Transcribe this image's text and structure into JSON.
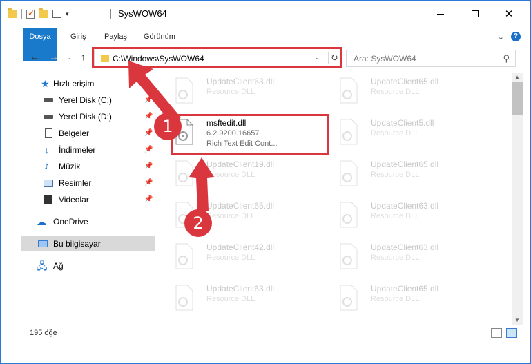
{
  "window": {
    "title": "SysWOW64"
  },
  "ribbon": {
    "tabs": [
      "Dosya",
      "Giriş",
      "Paylaş",
      "Görünüm"
    ],
    "help": "?"
  },
  "address": {
    "path": "C:\\Windows\\SysWOW64"
  },
  "search": {
    "placeholder": "Ara: SysWOW64"
  },
  "nav_pane": {
    "items": [
      {
        "label": "Hızlı erişim",
        "icon": "star-icon"
      },
      {
        "label": "Yerel Disk (C:)",
        "icon": "drive-icon",
        "pinned": true
      },
      {
        "label": "Yerel Disk (D:)",
        "icon": "drive-icon",
        "pinned": true
      },
      {
        "label": "Belgeler",
        "icon": "documents-icon",
        "pinned": true
      },
      {
        "label": "İndirmeler",
        "icon": "downloads-icon",
        "pinned": true
      },
      {
        "label": "Müzik",
        "icon": "music-icon",
        "pinned": true
      },
      {
        "label": "Resimler",
        "icon": "pictures-icon",
        "pinned": true
      },
      {
        "label": "Videolar",
        "icon": "videos-icon",
        "pinned": true
      },
      {
        "label": "OneDrive",
        "icon": "cloud-icon"
      },
      {
        "label": "Bu bilgisayar",
        "icon": "computer-icon",
        "selected": true
      },
      {
        "label": "Ağ",
        "icon": "network-icon"
      }
    ]
  },
  "files": [
    {
      "name": "UpdateClient63.dll",
      "type": "Resource DLL",
      "faded": true
    },
    {
      "name": "UpdateClient65.dll",
      "type": "Resource DLL",
      "faded": true
    },
    {
      "name": "msftedit.dll",
      "version": "6.2.9200.16657",
      "description": "Rich Text Edit Cont...",
      "faded": false
    },
    {
      "name": "UpdateClient5.dll",
      "type": "Resource DLL",
      "faded": true
    },
    {
      "name": "UpdateClient19.dll",
      "type": "Resource DLL",
      "faded": true
    },
    {
      "name": "UpdateClient65.dll",
      "type": "Resource DLL",
      "faded": true
    },
    {
      "name": "UpdateClient65.dll",
      "type": "Resource DLL",
      "faded": true
    },
    {
      "name": "UpdateClient63.dll",
      "type": "Resource DLL",
      "faded": true
    },
    {
      "name": "UpdateClient42.dll",
      "type": "Resource DLL",
      "faded": true
    },
    {
      "name": "UpdateClient63.dll",
      "type": "Resource DLL",
      "faded": true
    },
    {
      "name": "UpdateClient63.dll",
      "type": "Resource DLL",
      "faded": true
    },
    {
      "name": "UpdateClient65.dll",
      "type": "Resource DLL",
      "faded": true
    }
  ],
  "status": {
    "count": "195 öğe"
  },
  "callouts": [
    "1",
    "2"
  ],
  "colors": {
    "accent": "#1979ca",
    "highlight": "#d9363e"
  }
}
